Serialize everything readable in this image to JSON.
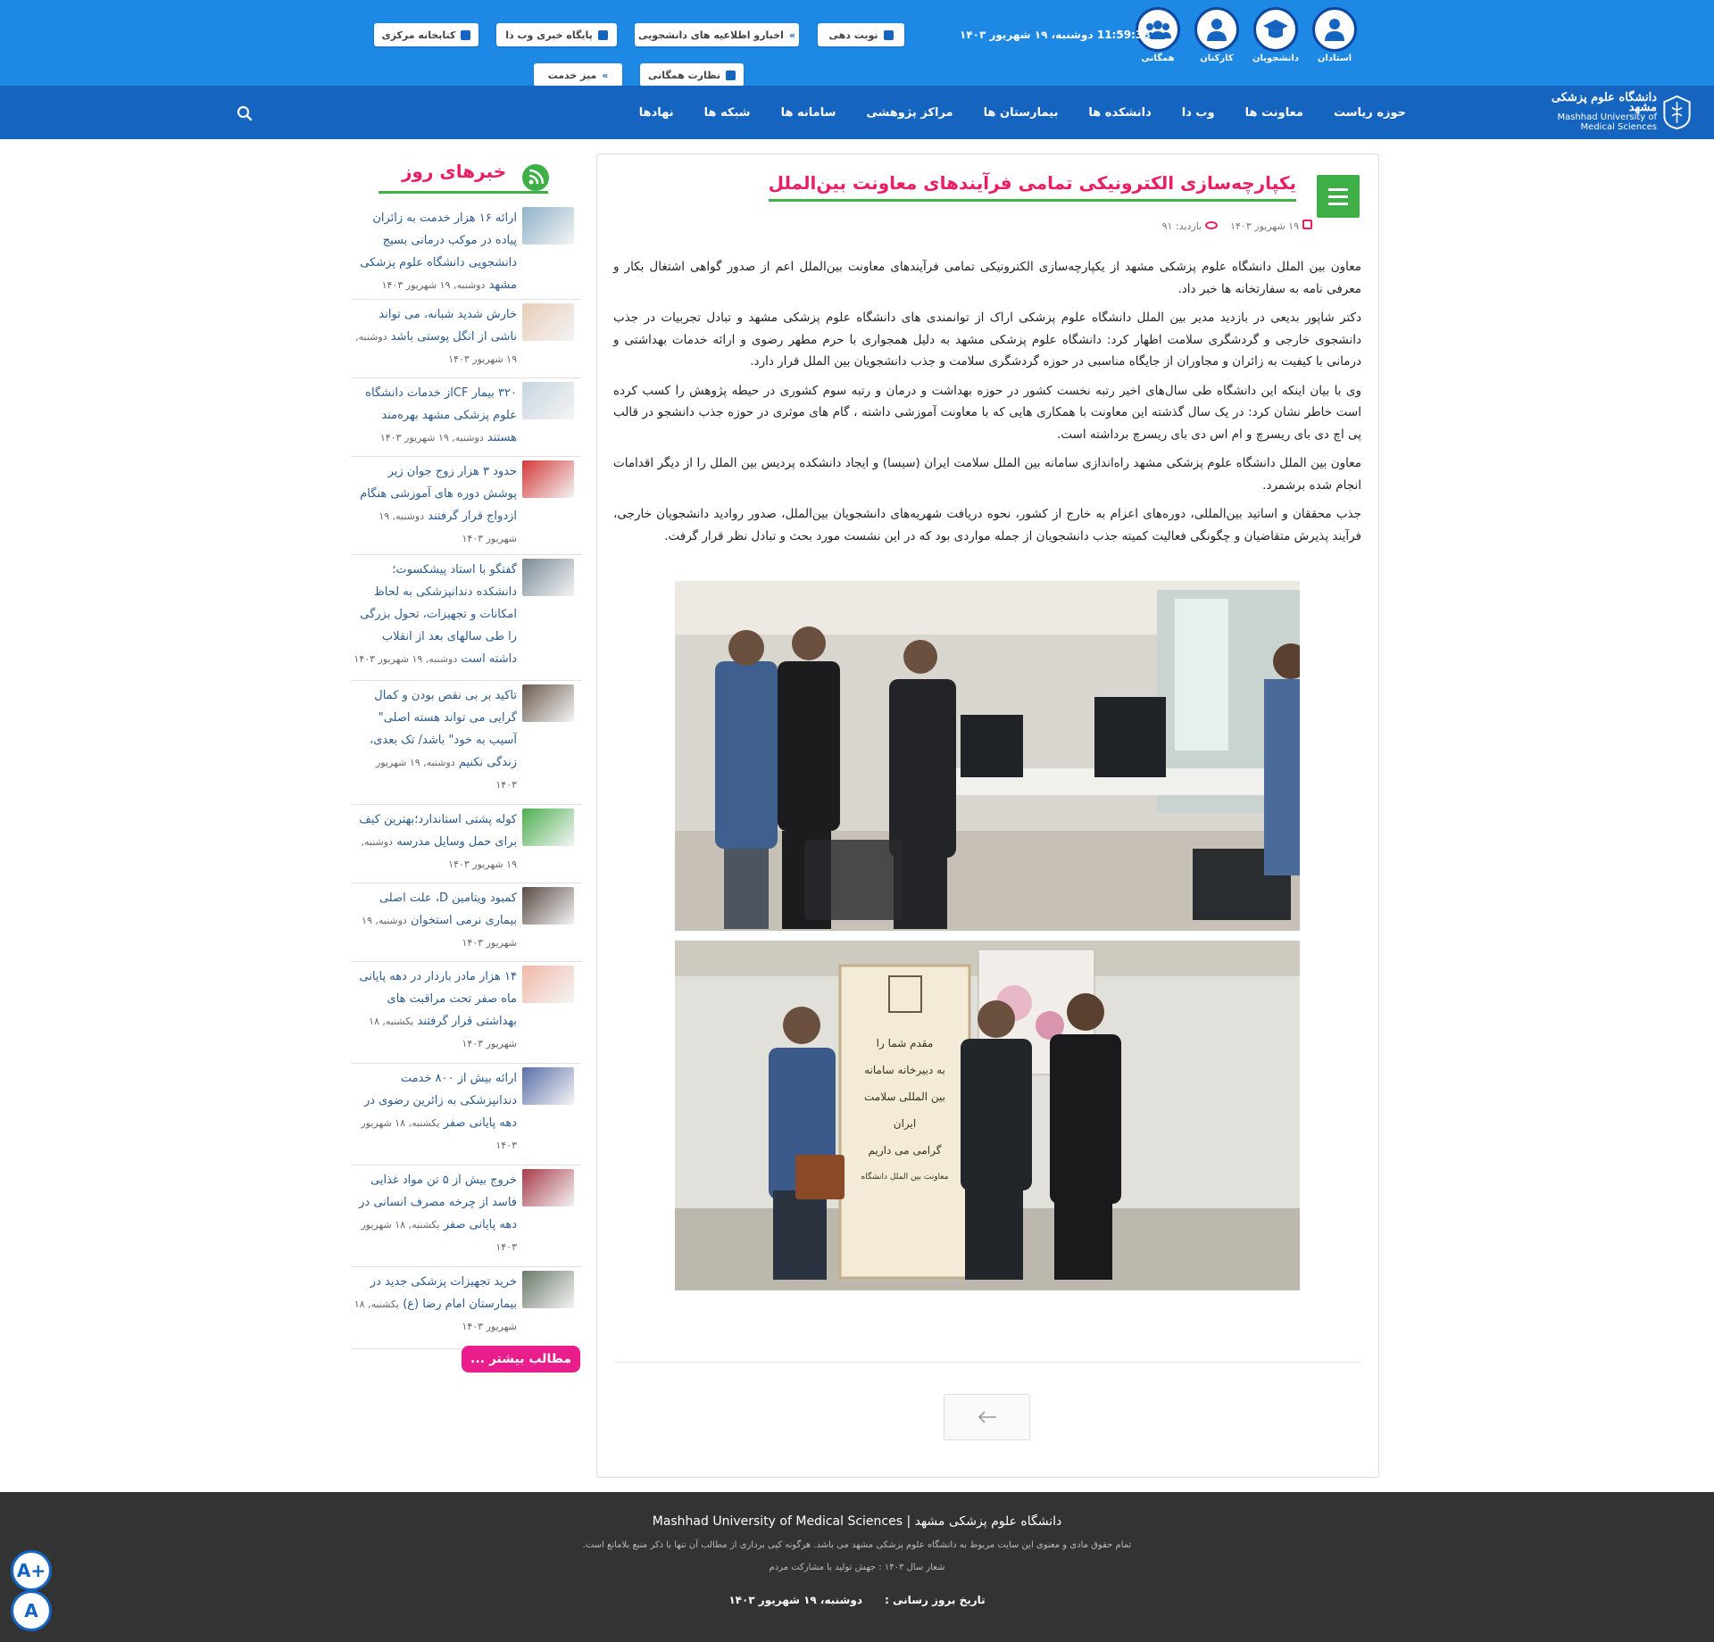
{
  "header": {
    "clock": "11:59:38",
    "date": "دوشنبه، ۱۹ شهریور ۱۴۰۳",
    "roles": [
      {
        "label": "استادان",
        "icon": "professor-icon"
      },
      {
        "label": "دانشجویان",
        "icon": "graduation-cap-icon"
      },
      {
        "label": "کارکنان",
        "icon": "staff-icon"
      },
      {
        "label": "همگانی",
        "icon": "public-users-icon"
      }
    ],
    "top_buttons": [
      {
        "label": "نوبت دهی",
        "icon": "user-icon"
      },
      {
        "label": "اخبارو اطلاعیه های دانشجویی",
        "icon": "double-chevron-icon"
      },
      {
        "label": "پایگاه خبری وب دا",
        "icon": "newspaper-icon"
      },
      {
        "label": "کتابخانه مرکزی",
        "icon": "book-icon"
      },
      {
        "label": "نظارت همگانی",
        "icon": "document-icon"
      },
      {
        "label": "میز خدمت",
        "icon": "double-chevron-icon"
      }
    ]
  },
  "logo": {
    "fa": "دانشگاه علوم پزشکی مشهد",
    "en1": "Mashhad University of",
    "en2": "Medical Sciences"
  },
  "nav": {
    "items": [
      "حوزه ریاست",
      "معاونت ها",
      "وب دا",
      "دانشکده ها",
      "بیمارستان ها",
      "مراکز پژوهشی",
      "سامانه ها",
      "شبکه ها",
      "نهادها"
    ]
  },
  "article": {
    "title": "یکپارچه‌سازی الکترونیکی تمامی فرآیندهای معاونت بین‌الملل",
    "date": "۱۹ شهریور ۱۴۰۳",
    "visits": "بازدید: ۹۱",
    "paragraphs": [
      "معاون بین الملل دانشگاه علوم پزشکی مشهد از یکپارچه‌سازی الکترونیکی تمامی فرآیندهای معاونت بین‌الملل اعم از صدور گواهی اشتغال بکار و معرفی نامه به سفارتخانه ها خبر داد.",
      "دکتر شاپور بدیعی در بازدید مدیر بین الملل دانشگاه علوم پزشکی اراک از توانمندی های دانشگاه علوم پزشکی مشهد و تبادل تجربیات در جذب دانشجوی خارجی و گردشگری سلامت اظهار کرد: دانشگاه علوم پزشکی مشهد به دلیل همجواری با حرم مطهر رضوی و ارائه خدمات بهداشتی و درمانی با کیفیت به زائران و مجاوران از جایگاه مناسبی در حوزه گردشگری سلامت و جذب دانشجویان بین الملل قرار دارد.",
      "وی با بیان اینکه این دانشگاه طی سال‌های اخیر رتبه نخست کشور در حوزه بهداشت و درمان و رتبه سوم کشوری در حیطه پژوهش را کسب کرده است خاطر نشان کرد: در یک سال گذشته این معاونت با همکاری هایی که با معاونت آموزشی داشته ، گام های موثری در حوزه جذب دانشجو در قالب پی اچ دی بای ریسرچ و ام اس دی بای ریسرچ برداشته است.",
      "معاون بین الملل دانشگاه علوم پزشکی مشهد راه‌اندازی سامانه بین الملل سلامت ایران (سیسا) و ایجاد دانشکده پردیس بین الملل را از دیگر اقدامات انجام شده برشمرد.",
      "جذب محققان و اساتید بین‌المللی، دوره‌های اعزام به خارج از کشور، نحوه دریافت شهریه‌های دانشجویان بین‌الملل، صدور روادید دانشجویان خارجی، فرآیند پذیرش متقاضیان و چگونگی فعالیت کمیته جذب دانشجویان از جمله مواردی بود که در این نشست مورد بحث و تبادل نظر قرار گرفت."
    ],
    "photo2_banner": [
      "مقدم شما را",
      "به دبیرخانه سامانه",
      "بین المللی سلامت ایران",
      "گرامی می داریم",
      "معاونت بین الملل دانشگاه"
    ]
  },
  "sidebar": {
    "title": "خبرهای روز",
    "more": "مطالب بیشتر ...",
    "news": [
      {
        "text": "ارائه ۱۶ هزار خدمت به زائران پیاده در موکب درمانی بسیج دانشجویی دانشگاه علوم پزشکی مشهد",
        "date": "دوشنبه, ۱۹ شهریور ۱۴۰۳",
        "color": "#8fb3c9"
      },
      {
        "text": "خارش شدید شبانه، می تواند ناشی از انگل پوستی باشد",
        "date": "دوشنبه, ۱۹ شهریور ۱۴۰۳",
        "color": "#e8cdb8"
      },
      {
        "text": "۳۲۰ بیمار CFاز خدمات دانشگاه علوم پزشکی مشهد بهره‌مند هستند",
        "date": "دوشنبه, ۱۹ شهریور ۱۴۰۳",
        "color": "#c7d6e0"
      },
      {
        "text": "حدود ۳ هزار زوج جوان زیر پوشش دوره های آموزشی هنگام ازدواج قرار گرفتند",
        "date": "دوشنبه, ۱۹ شهریور ۱۴۰۳",
        "color": "#d43a3a"
      },
      {
        "text": "گفتگو با استاد پیشکسوت؛ دانشکده دندانپزشکی به لحاظ امکانات و تجهیزات، تحول بزرگی را طی سالهای بعد از انقلاب داشته است",
        "date": "دوشنبه, ۱۹ شهریور ۱۴۰۳",
        "color": "#7a8a96"
      },
      {
        "text": "تاکید بر بی نقص بودن و کمال گرایی می تواند هسته اصلی\" آسیب به خود\" باشد/ تک بعدی، زندگی نکنیم",
        "date": "دوشنبه, ۱۹ شهریور ۱۴۰۳",
        "color": "#6b5a4e"
      },
      {
        "text": "کوله پشتی استاندارد؛بهترین کیف برای حمل وسایل مدرسه",
        "date": "دوشنبه, ۱۹ شهریور ۱۴۰۳",
        "color": "#4caf50"
      },
      {
        "text": "کمبود ویتامین D، علت اصلی بیماری نرمی استخوان",
        "date": "دوشنبه, ۱۹ شهریور ۱۴۰۳",
        "color": "#5a4a44"
      },
      {
        "text": "۱۴ هزار مادر باردار در دهه پایانی ماه صفر تحت مراقبت های بهداشتی قرار گرفتند",
        "date": "یکشنبه, ۱۸ شهریور ۱۴۰۳",
        "color": "#f2b8a8"
      },
      {
        "text": "ارائه بیش از ۸۰۰ خدمت دندانپزشکی به زائرین رضوی در دهه پایانی صفر",
        "date": "یکشنبه, ۱۸ شهریور ۱۴۰۳",
        "color": "#5a6fa8"
      },
      {
        "text": "خروج بیش از ۵ تن مواد غذایی فاسد از چرخه مصرف انسانی در دهه پایانی صفر",
        "date": "یکشنبه, ۱۸ شهریور ۱۴۰۳",
        "color": "#a83a4a"
      },
      {
        "text": "خرید تجهیزات پزشکی جدید در بیمارستان امام رضا (ع)",
        "date": "یکشنبه, ۱۸ شهریور ۱۴۰۳",
        "color": "#6b7a6a"
      }
    ]
  },
  "footer": {
    "title": "دانشگاه علوم پزشکی مشهد | Mashhad University of Medical Sciences",
    "copyright": "تمام حقوق مادی و معنوی این سایت مربوط به دانشگاه علوم پزشکی مشهد می باشد. هرگونه کپی برداری از مطالب آن تنها با ذکر منبع بلامانع است.",
    "slogan": "شعار سال ۱۴۰۳ : جهش تولید با مشارکت مردم",
    "update_label": "تاریخ بروز رسانی :",
    "update_date": "دوشنبه، ۱۹ شهریور ۱۴۰۳"
  },
  "a11y": {
    "increase": "A+",
    "decrease": "A"
  }
}
